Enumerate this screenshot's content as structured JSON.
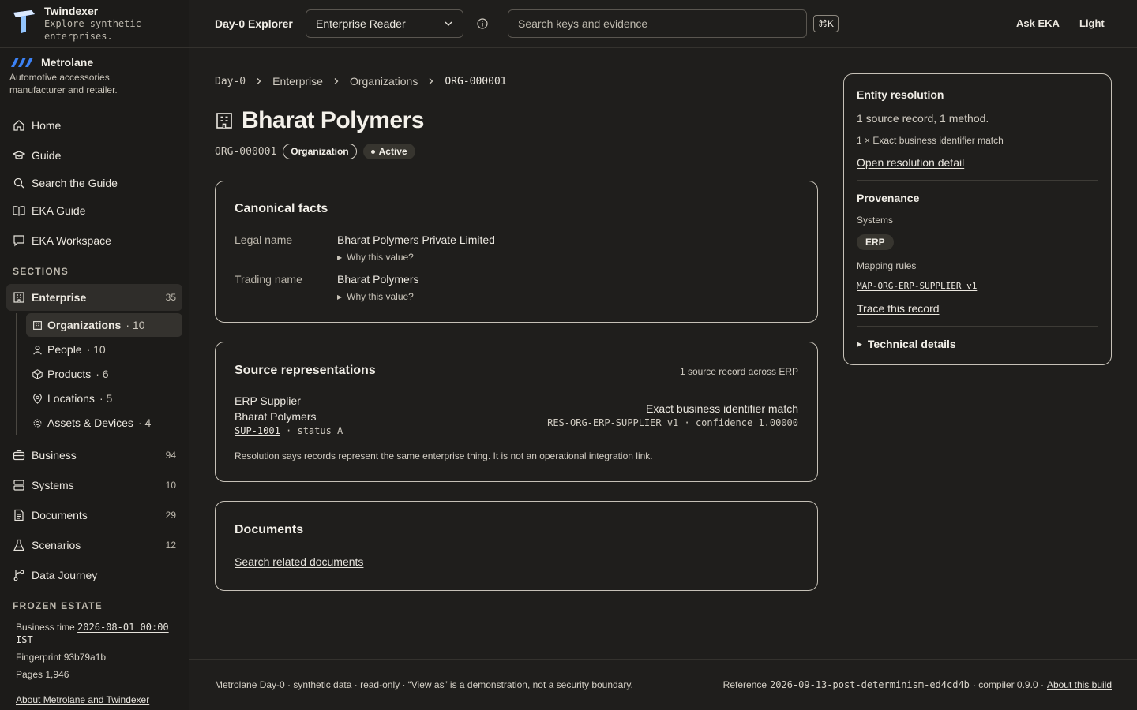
{
  "brand": {
    "name": "Twindexer",
    "tagline": "Explore synthetic enterprises."
  },
  "tenant": {
    "name": "Metrolane",
    "description": "Automotive accessories manufacturer and retailer."
  },
  "nav": {
    "home": "Home",
    "guide": "Guide",
    "search_guide": "Search the Guide",
    "eka_guide": "EKA Guide",
    "eka_workspace": "EKA Workspace",
    "sections_label": "SECTIONS",
    "enterprise": {
      "label": "Enterprise",
      "count": "35"
    },
    "sub": [
      {
        "label": "Organizations",
        "count": "· 10"
      },
      {
        "label": "People",
        "count": "· 10"
      },
      {
        "label": "Products",
        "count": "· 6"
      },
      {
        "label": "Locations",
        "count": "· 5"
      },
      {
        "label": "Assets & Devices",
        "count": "· 4"
      }
    ],
    "business": {
      "label": "Business",
      "count": "94"
    },
    "systems": {
      "label": "Systems",
      "count": "10"
    },
    "documents": {
      "label": "Documents",
      "count": "29"
    },
    "scenarios": {
      "label": "Scenarios",
      "count": "12"
    },
    "data_journey": "Data Journey"
  },
  "frozen": {
    "label": "FROZEN ESTATE",
    "business_time_label": "Business time",
    "business_time_value": "2026-08-01 00:00 IST",
    "fingerprint": "Fingerprint 93b79a1b",
    "pages": "Pages 1,946",
    "about": "About Metrolane and Twindexer"
  },
  "topbar": {
    "title": "Day-0 Explorer",
    "role": "Enterprise Reader",
    "search_placeholder": "Search keys and evidence",
    "shortcut": "⌘K",
    "ask": "Ask EKA",
    "theme": "Light"
  },
  "breadcrumb": [
    "Day-0",
    "Enterprise",
    "Organizations",
    "ORG-000001"
  ],
  "page": {
    "title": "Bharat Polymers",
    "id": "ORG-000001",
    "type_badge": "Organization",
    "status_badge": "Active"
  },
  "canonical": {
    "title": "Canonical facts",
    "facts": [
      {
        "label": "Legal name",
        "value": "Bharat Polymers Private Limited",
        "why": "Why this value?"
      },
      {
        "label": "Trading name",
        "value": "Bharat Polymers",
        "why": "Why this value?"
      }
    ]
  },
  "sources": {
    "title": "Source representations",
    "summary": "1 source record across ERP",
    "system": "ERP Supplier",
    "name": "Bharat Polymers",
    "record_id": "SUP-1001",
    "record_status": "· status A",
    "match": "Exact business identifier match",
    "match_detail": "RES-ORG-ERP-SUPPLIER v1 · confidence 1.00000",
    "note": "Resolution says records represent the same enterprise thing. It is not an operational integration link."
  },
  "documents": {
    "title": "Documents",
    "link": "Search related documents"
  },
  "entity_resolution": {
    "title": "Entity resolution",
    "summary": "1 source record, 1 method.",
    "method": "1 × Exact business identifier match",
    "link": "Open resolution detail"
  },
  "provenance": {
    "title": "Provenance",
    "systems_label": "Systems",
    "system": "ERP",
    "rules_label": "Mapping rules",
    "rule": "MAP-ORG-ERP-SUPPLIER v1",
    "trace": "Trace this record",
    "technical": "Technical details"
  },
  "footer": {
    "left": "Metrolane Day-0 · synthetic data · read-only · “View as” is a demonstration, not a security boundary.",
    "ref_label": "Reference",
    "ref_value": "2026-09-13-post-determinism-ed4cd4b",
    "compiler": "· compiler 0.9.0 ·",
    "about": "About this build"
  },
  "colors": {
    "background": "#1f1e1c",
    "text": "#e6e3dc",
    "border": "#c6c1b7",
    "accent_blue": "#3b82f6"
  }
}
